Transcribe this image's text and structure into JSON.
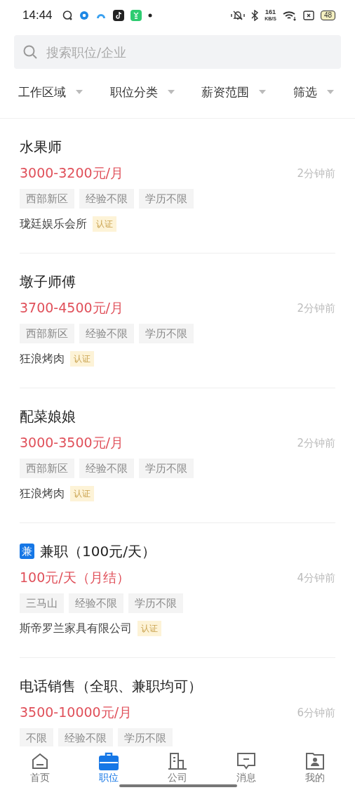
{
  "status_bar": {
    "time": "14:44",
    "network_speed": "161",
    "network_unit": "KB/S",
    "battery": "48"
  },
  "search": {
    "placeholder": "搜索职位/企业"
  },
  "filters": [
    {
      "label": "工作区域"
    },
    {
      "label": "职位分类"
    },
    {
      "label": "薪资范围"
    },
    {
      "label": "筛选"
    }
  ],
  "jobs": [
    {
      "title": "水果师",
      "salary": "3000-3200元/月",
      "time": "2分钟前",
      "tags": [
        "西部新区",
        "经验不限",
        "学历不限"
      ],
      "company": "珑廷娱乐会所",
      "verified_label": "认证"
    },
    {
      "title": "墩子师傅",
      "salary": "3700-4500元/月",
      "time": "2分钟前",
      "tags": [
        "西部新区",
        "经验不限",
        "学历不限"
      ],
      "company": "狂浪烤肉",
      "verified_label": "认证"
    },
    {
      "title": "配菜娘娘",
      "salary": "3000-3500元/月",
      "time": "2分钟前",
      "tags": [
        "西部新区",
        "经验不限",
        "学历不限"
      ],
      "company": "狂浪烤肉",
      "verified_label": "认证"
    },
    {
      "badge": "兼",
      "title": "兼职（100元/天）",
      "salary": "100元/天（月结）",
      "time": "4分钟前",
      "tags": [
        "三马山",
        "经验不限",
        "学历不限"
      ],
      "company": "斯帝罗兰家具有限公司",
      "verified_label": "认证"
    },
    {
      "title": "电话销售（全职、兼职均可）",
      "salary": "3500-10000元/月",
      "time": "6分钟前",
      "tags": [
        "不限",
        "经验不限",
        "学历不限"
      ]
    }
  ],
  "tab_bar": [
    {
      "label": "首页",
      "kind": "home",
      "selected": false
    },
    {
      "label": "职位",
      "kind": "jobs",
      "selected": true
    },
    {
      "label": "公司",
      "kind": "company",
      "selected": false
    },
    {
      "label": "消息",
      "kind": "messages",
      "selected": false
    },
    {
      "label": "我的",
      "kind": "profile",
      "selected": false
    }
  ]
}
